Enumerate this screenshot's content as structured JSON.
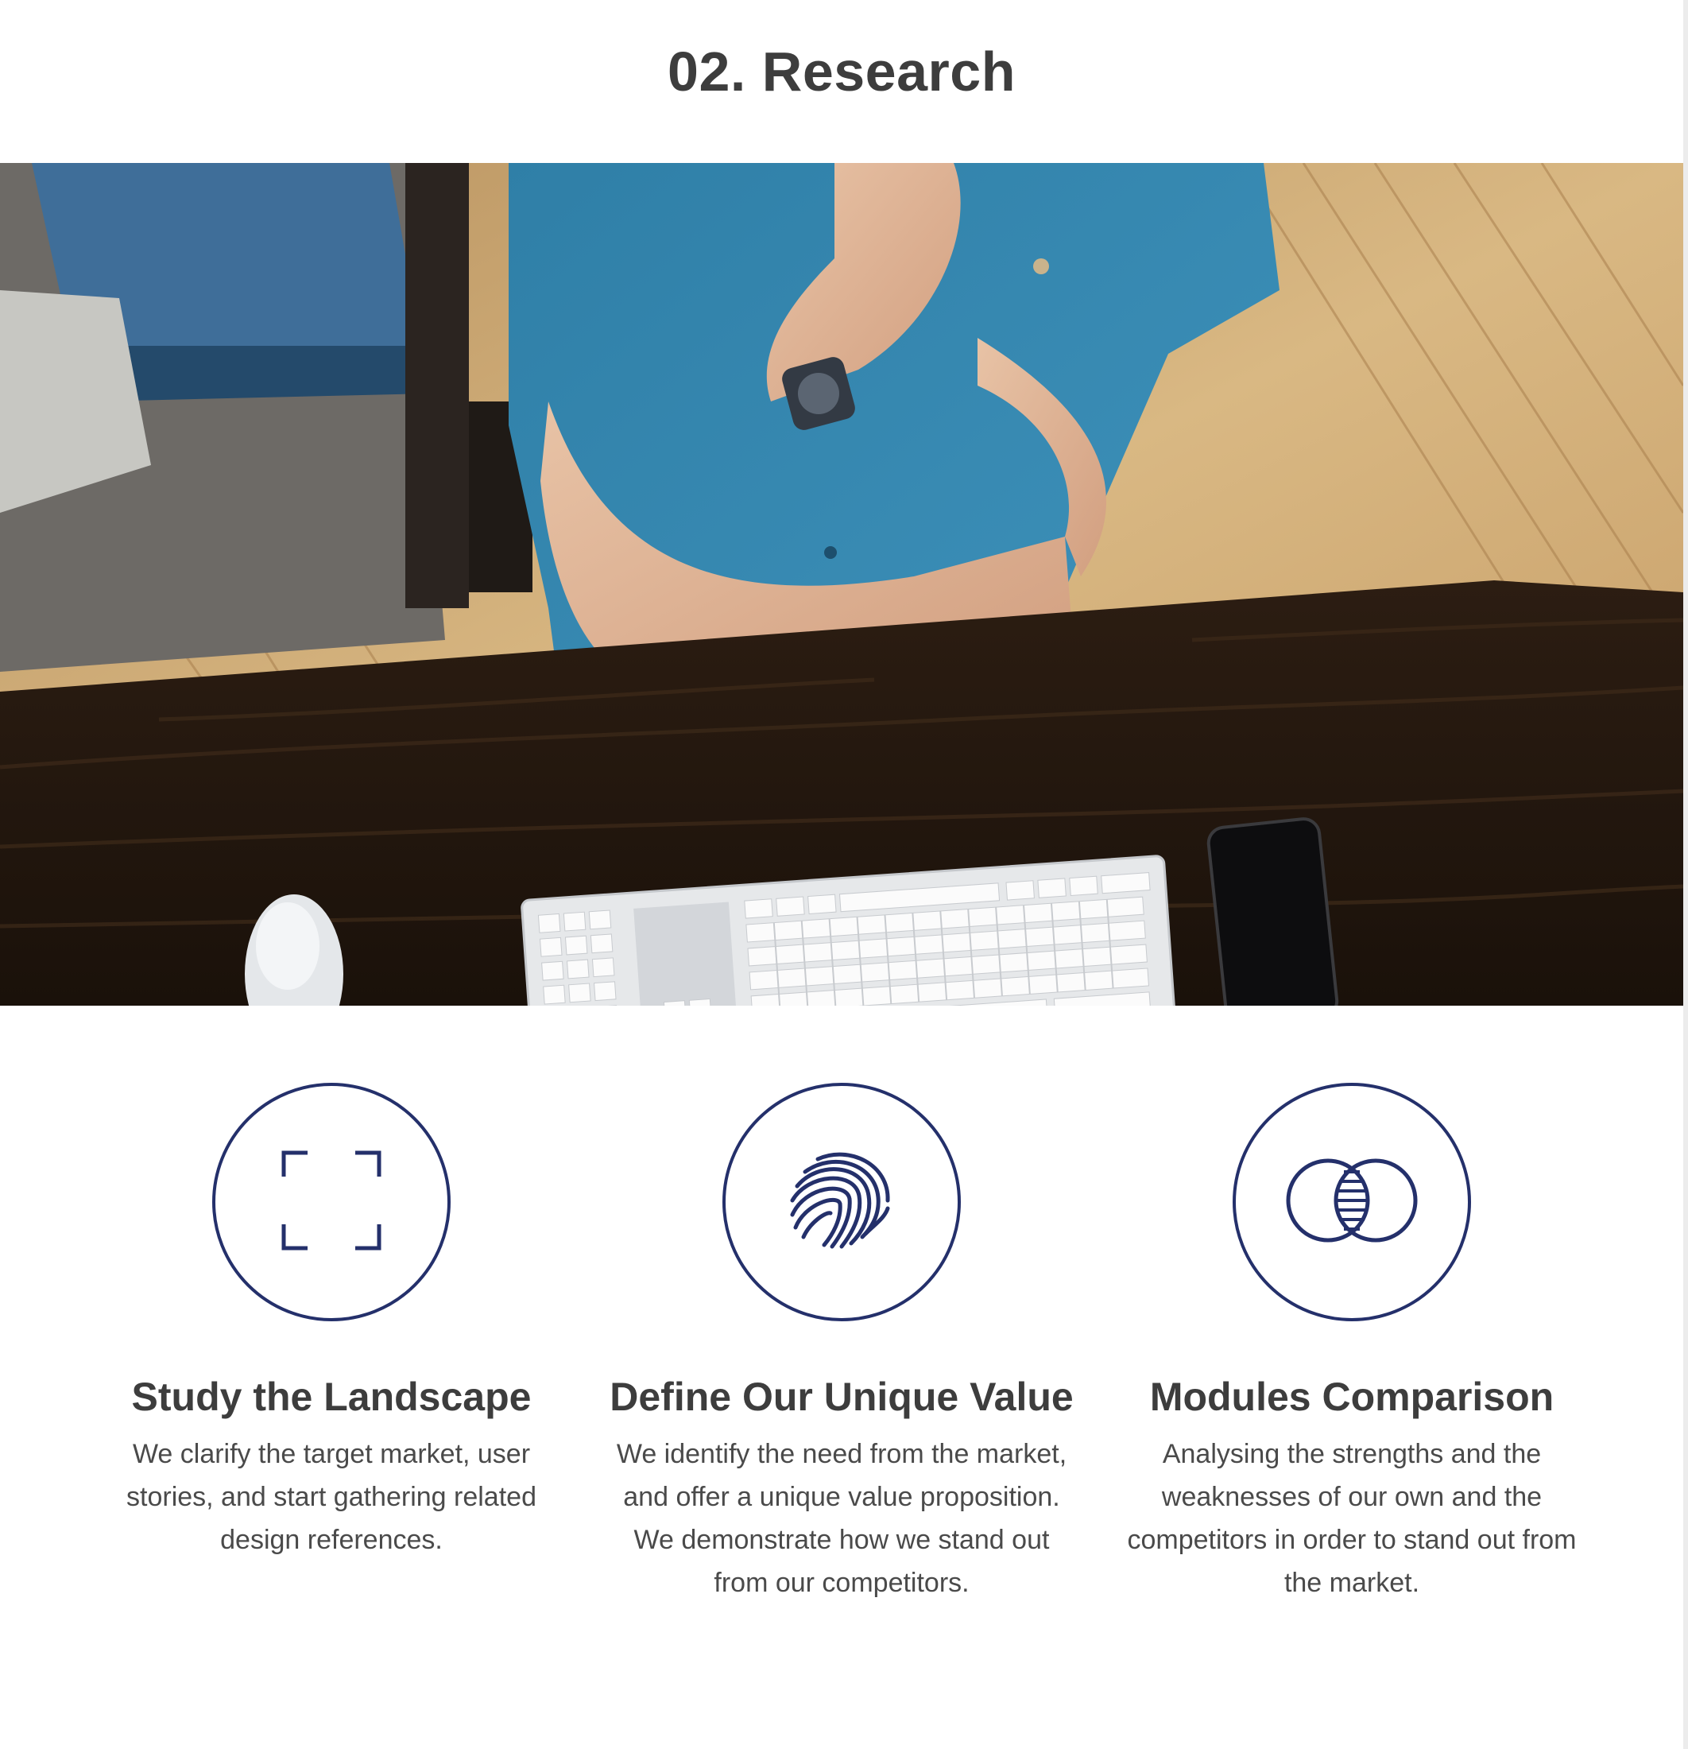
{
  "section": {
    "title": "02. Research"
  },
  "hero": {
    "alt": "Person with crossed arms standing behind a dark wooden desk with a keyboard, mouse and phone"
  },
  "features": [
    {
      "icon": "focus-frame-icon",
      "title": "Study the Landscape",
      "description": "We clarify the target market, user stories, and start gathering related design references."
    },
    {
      "icon": "fingerprint-icon",
      "title": "Define Our Unique Value",
      "description": "We identify the need from the market, and offer a unique value proposition. We demonstrate how we stand out from our competitors."
    },
    {
      "icon": "venn-diagram-icon",
      "title": "Modules Comparison",
      "description": "Analysing the strengths and the weaknesses of our own and the competitors in order to stand out from the market."
    }
  ],
  "colors": {
    "accent": "#24306b",
    "heading": "#3d3d3d",
    "body": "#4a4a4a"
  }
}
